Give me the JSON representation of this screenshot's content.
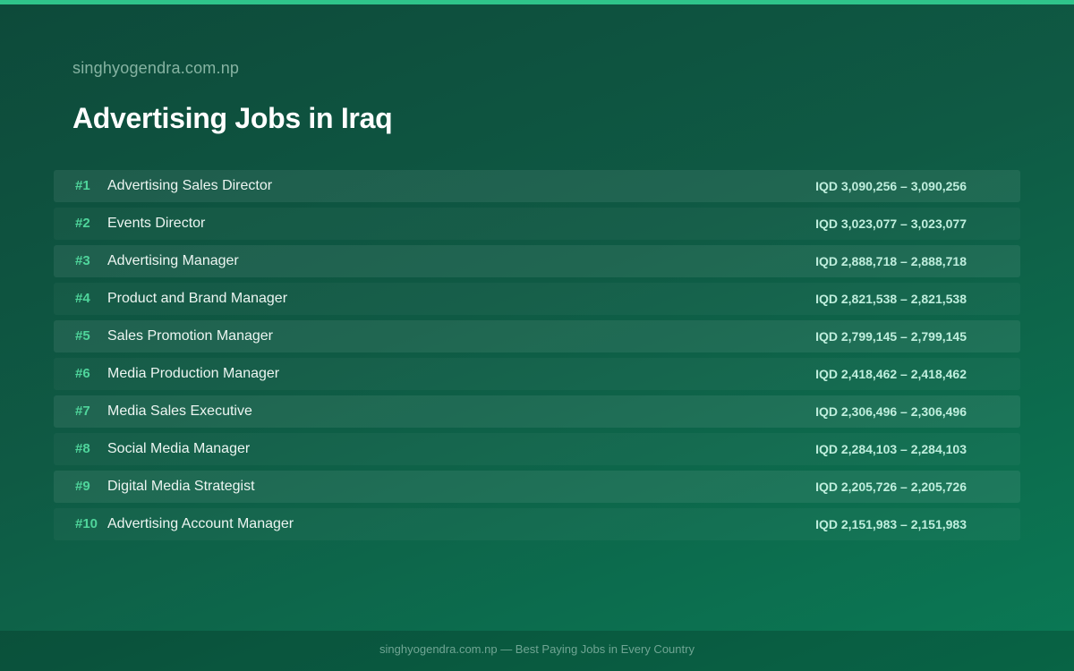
{
  "header": {
    "site": "singhyogendra.com.np",
    "title": "Advertising Jobs in Iraq"
  },
  "jobs": [
    {
      "rank": "#1",
      "title": "Advertising Sales Director",
      "salary": "IQD 3,090,256 – 3,090,256"
    },
    {
      "rank": "#2",
      "title": "Events Director",
      "salary": "IQD 3,023,077 – 3,023,077"
    },
    {
      "rank": "#3",
      "title": "Advertising Manager",
      "salary": "IQD 2,888,718 – 2,888,718"
    },
    {
      "rank": "#4",
      "title": "Product and Brand Manager",
      "salary": "IQD 2,821,538 – 2,821,538"
    },
    {
      "rank": "#5",
      "title": "Sales Promotion Manager",
      "salary": "IQD 2,799,145 – 2,799,145"
    },
    {
      "rank": "#6",
      "title": "Media Production Manager",
      "salary": "IQD 2,418,462 – 2,418,462"
    },
    {
      "rank": "#7",
      "title": "Media Sales Executive",
      "salary": "IQD 2,306,496 – 2,306,496"
    },
    {
      "rank": "#8",
      "title": "Social Media Manager",
      "salary": "IQD 2,284,103 – 2,284,103"
    },
    {
      "rank": "#9",
      "title": "Digital Media Strategist",
      "salary": "IQD 2,205,726 – 2,205,726"
    },
    {
      "rank": "#10",
      "title": "Advertising Account Manager",
      "salary": "IQD 2,151,983 – 2,151,983"
    }
  ],
  "footer": {
    "text": "singhyogendra.com.np — Best Paying Jobs in Every Country"
  },
  "colors": {
    "accent": "#2fc48a",
    "rank": "#4fd59b",
    "salary": "#bfeedd"
  }
}
